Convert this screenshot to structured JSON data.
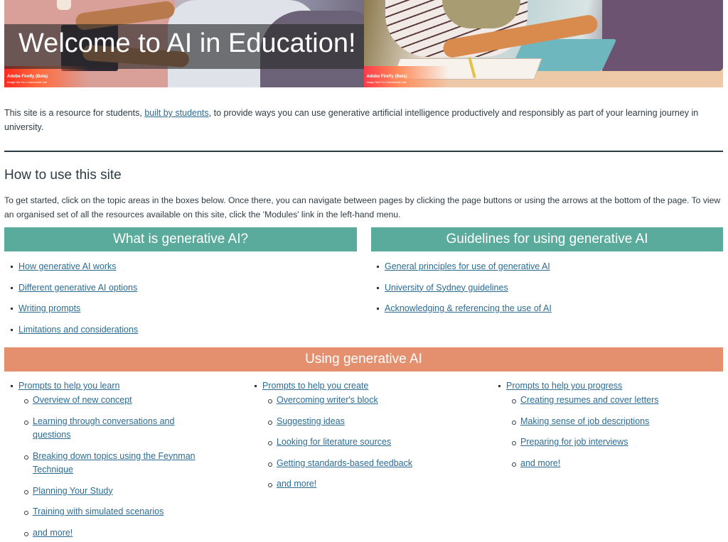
{
  "hero": {
    "title": "Welcome to AI in Education!",
    "watermark_line1": "Adobe Firefly (Beta)",
    "watermark_line2": "Image Not For Commercial Use"
  },
  "intro": {
    "text_before": "This site is a resource for students, ",
    "link": "built by students",
    "text_after": ", to provide ways you can use generative artificial intelligence productively and responsibly as part of your learning journey in university."
  },
  "how_to": {
    "heading": "How to use this site",
    "text": "To get started, click on the topic areas in the boxes below. Once there, you can navigate between pages by clicking the page buttons or using the arrows at the bottom of the page. To view an organised set of all the resources available on this site, click the 'Modules' link in the left-hand menu."
  },
  "colors": {
    "teal_header": "#5aab9c",
    "salmon_header": "#e4906f",
    "link": "#2b6c94",
    "text": "#2d3b45"
  },
  "what_is": {
    "header": "What is generative AI?",
    "items": [
      "How generative AI works",
      "Different generative AI options",
      "Writing prompts",
      "Limitations and considerations"
    ]
  },
  "guidelines": {
    "header": "Guidelines for using generative AI",
    "items": [
      "General principles for use of generative AI",
      "University of Sydney guidelines",
      "Acknowledging & referencing the use of AI"
    ]
  },
  "using": {
    "header": "Using generative AI",
    "columns": [
      {
        "title": "Prompts to help you learn",
        "items": [
          "Overview of new concept",
          "Learning through conversations and questions",
          "Breaking down topics using the Feynman Technique",
          "Planning Your Study",
          "Training with simulated scenarios",
          "and more!"
        ]
      },
      {
        "title": "Prompts to help you create",
        "items": [
          "Overcoming writer's block",
          "Suggesting ideas",
          "Looking for literature sources",
          "Getting standards-based feedback",
          "and more!"
        ]
      },
      {
        "title": "Prompts to help you progress",
        "items": [
          "Creating resumes and cover letters",
          "Making sense of job descriptions",
          "Preparing for job interviews",
          "and more!"
        ]
      }
    ]
  }
}
